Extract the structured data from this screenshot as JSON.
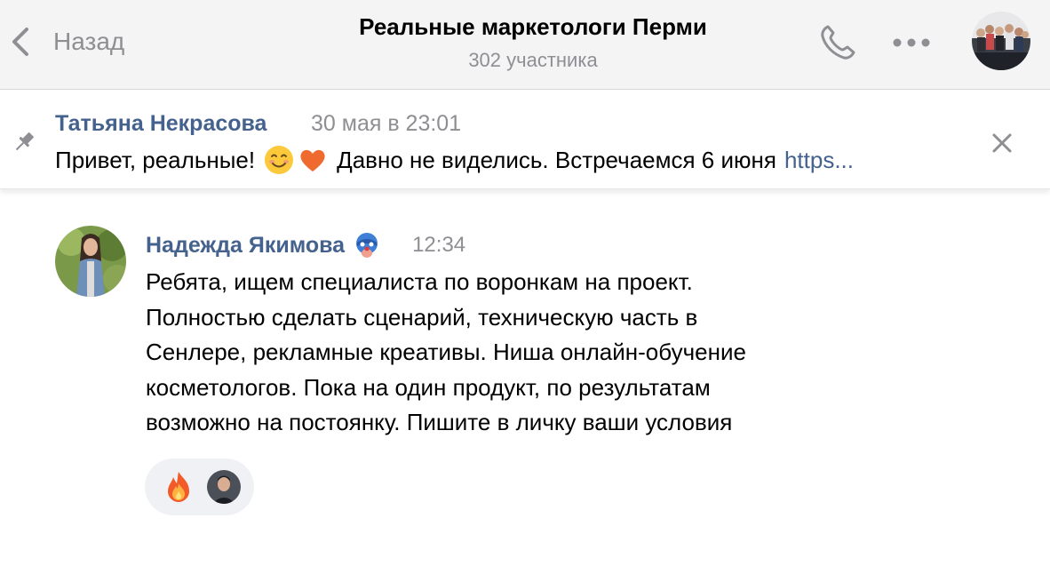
{
  "header": {
    "back_label": "Назад",
    "title": "Реальные маркетологи Перми",
    "subtitle": "302 участника",
    "icons": [
      "chevron-left-icon",
      "phone-icon",
      "more-dots-icon"
    ]
  },
  "pinned": {
    "author": "Татьяна Некрасова",
    "date": "30 мая в 23:01",
    "text_before": "Привет, реальные!",
    "emojis": [
      "smiling-face-emoji",
      "orange-heart-emoji"
    ],
    "text_after": "Давно не виделись. Встречаемся 6 июня",
    "link": "https...",
    "icons": [
      "pin-icon",
      "close-icon"
    ]
  },
  "message": {
    "author": "Надежда Якимова",
    "badge_icon": "clown-mask-icon",
    "time": "12:34",
    "lines": [
      "Ребята, ищем специалиста по воронкам на проект.",
      "Полностью сделать сценарий, техническую часть в",
      "Сенлере, рекламные креативы. Ниша онлайн-обучение",
      "косметологов. Пока на один продукт, по результатам",
      "возможно на постоянку. Пишите в личку ваши условия"
    ],
    "reactions": {
      "emoji": "fire-emoji"
    }
  },
  "colors": {
    "accent": "#44628d",
    "muted": "#8e8e93",
    "header_bg": "#f4f4f5",
    "reaction_bg": "#f0f1f4"
  }
}
